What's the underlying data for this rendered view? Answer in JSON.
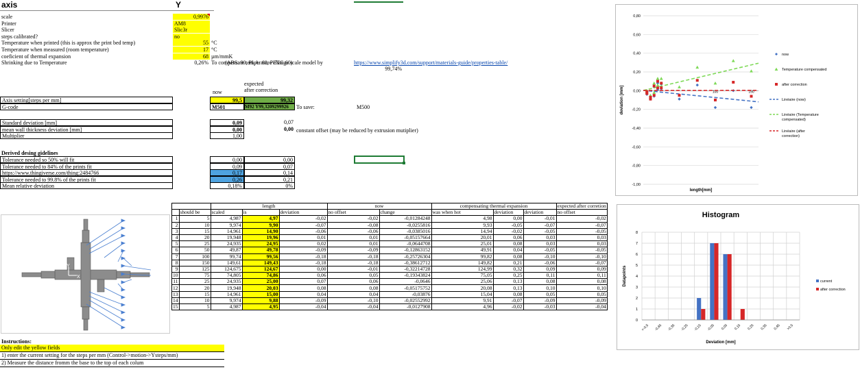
{
  "header": {
    "axis_title": "axis",
    "col_title": "Y"
  },
  "params": [
    {
      "label": "scale",
      "value": "0,9976",
      "unit": ""
    },
    {
      "label": "Printer",
      "value": "AM8",
      "unit": ""
    },
    {
      "label": "Slicer",
      "value": "Slic3r",
      "unit": ""
    },
    {
      "label": "steps calibrated?",
      "value": "no",
      "unit": ""
    },
    {
      "label": "Temperature when printed (this is approx the print bed temp)",
      "value": "55",
      "unit": "°C"
    },
    {
      "label": "Temperature when measured (room temperature)",
      "value": "17",
      "unit": "°C"
    },
    {
      "label": "coeficient of thermal expansion",
      "value": "68",
      "unit": "µm/mmK"
    },
    {
      "label": "Shrinking due to Temperature",
      "value": "0,26%",
      "unit": "To compensate temperature change scale model by"
    }
  ],
  "abs_note": "(ABS: 90, PLA: 68, PETG 60)",
  "link_simplify": "https://www.simplify3d.com/support/materials-guide/properties-table/",
  "compensate_pct": "99,74%",
  "expected_label": "expected",
  "after_correction_label": "after correction",
  "now_label": "now",
  "axis_setting": {
    "label": "Axis setting[steps per mm]",
    "now": "99,5",
    "after": "99,32"
  },
  "gcode": {
    "label": "G-code",
    "now": "M501",
    "after": "M92 Y99,3209299926",
    "to_save": "To save:",
    "save_cmd": "M500"
  },
  "stats": [
    {
      "label": "Standard deviation [mm]",
      "now": "0,09",
      "after": "0,07"
    },
    {
      "label": "mean wall thickness deviation [mm]",
      "now": "0,00",
      "after": "0,00"
    },
    {
      "label": "Multiplier",
      "now": "1,00",
      "after": ""
    }
  ],
  "constant_offset_note": "constant offset (may be reduced by extrusion mutiplier)",
  "guidelines_title": "Derived desing gidelines",
  "guidelines": [
    {
      "label": "Tolerance needed so 50% will fit",
      "now": "0,00",
      "after": "0,00"
    },
    {
      "label": "Tolerance needed to 84% of the prints fit",
      "now": "0,09",
      "after": "0,07"
    },
    {
      "label": "https://www.thingiverse.com/thing:2484766",
      "now": "0,17",
      "after": "0,14"
    },
    {
      "label": "Tolerance needed to 99.8% of the prints fit",
      "now": "0,26",
      "after": "0,21"
    },
    {
      "label": "Mean relative deviation",
      "now": "0,18%",
      "after": "0%"
    }
  ],
  "table": {
    "group_length": "length",
    "group_now": "now",
    "group_comp": "compensating thermal expansion",
    "group_expected": "expected after corretion",
    "headers": [
      "should be",
      "scaled",
      "is",
      "deviation",
      "no offset",
      "change",
      "was when hot",
      "deviation",
      "deviation",
      "no offset"
    ],
    "rows": [
      [
        "1",
        "5",
        "4,987",
        "4,97",
        "-0,02",
        "-0,02",
        "-0,01284248",
        "4,98",
        "0,00",
        "-0,01",
        "-0,02"
      ],
      [
        "2",
        "10",
        "9,974",
        "9,90",
        "-0,07",
        "-0,08",
        "-0,0255816",
        "9,93",
        "-0,05",
        "-0,07",
        "-0,07"
      ],
      [
        "3",
        "15",
        "14,961",
        "14,90",
        "-0,06",
        "-0,06",
        "-0,0385016",
        "14,94",
        "-0,02",
        "-0,05",
        "-0,05"
      ],
      [
        "4",
        "20",
        "19,948",
        "19,96",
        "0,01",
        "0,01",
        "-0,05157664",
        "20,01",
        "0,06",
        "0,03",
        "0,03"
      ],
      [
        "5",
        "25",
        "24,935",
        "24,95",
        "0,02",
        "0,01",
        "-0,0644708",
        "25,01",
        "0,08",
        "0,03",
        "0,03"
      ],
      [
        "6",
        "50",
        "49,87",
        "49,78",
        "-0,09",
        "-0,09",
        "-0,12863152",
        "49,91",
        "0,04",
        "-0,05",
        "-0,05"
      ],
      [
        "7",
        "100",
        "99,74",
        "99,56",
        "-0,18",
        "-0,18",
        "-0,25726304",
        "99,82",
        "0,08",
        "-0,10",
        "-0,10"
      ],
      [
        "8",
        "150",
        "149,61",
        "149,43",
        "-0,18",
        "-0,18",
        "-0,38612712",
        "149,82",
        "0,21",
        "-0,06",
        "-0,07"
      ],
      [
        "9",
        "125",
        "124,675",
        "124,67",
        "0,00",
        "-0,01",
        "-0,32214728",
        "124,99",
        "0,32",
        "0,09",
        "0,09"
      ],
      [
        "10",
        "75",
        "74,805",
        "74,86",
        "0,06",
        "0,05",
        "-0,19343824",
        "75,05",
        "0,25",
        "0,11",
        "0,11"
      ],
      [
        "11",
        "25",
        "24,935",
        "25,00",
        "0,07",
        "0,06",
        "-0,0646",
        "25,06",
        "0,13",
        "0,08",
        "0,08"
      ],
      [
        "12",
        "20",
        "19,948",
        "20,03",
        "0,08",
        "0,08",
        "-0,05175752",
        "20,08",
        "0,13",
        "0,10",
        "0,10"
      ],
      [
        "13",
        "15",
        "14,961",
        "15,00",
        "0,04",
        "0,04",
        "-0,03876",
        "15,04",
        "0,08",
        "0,05",
        "0,05"
      ],
      [
        "14",
        "10",
        "9,974",
        "9,88",
        "-0,09",
        "-0,10",
        "-0,02552992",
        "9,91",
        "-0,07",
        "-0,09",
        "-0,09"
      ],
      [
        "15",
        "5",
        "4,987",
        "4,95",
        "-0,04",
        "-0,04",
        "-0,0127908",
        "4,96",
        "-0,02",
        "-0,03",
        "-0,04"
      ]
    ]
  },
  "instructions": {
    "title": "Instructions:",
    "lines": [
      "Only edit the yellow fields",
      "1) enter the current setting for the steps per mm (Control->motion->Ysteps/mm)",
      "2) Measure the distance fromm the base to the top of each colum"
    ]
  },
  "colors": {
    "yellow": "#ffff00",
    "green": "#70ad47",
    "blue": "#4fa3e0",
    "now": "#4472c4",
    "temp": "#7ed957",
    "after": "#d62728"
  },
  "chart_data": [
    {
      "type": "scatter",
      "xlabel": "length[mm]",
      "ylabel": "deviation [mm]",
      "ylim": [
        -1.0,
        0.8
      ],
      "yticks": [
        "0,80",
        "0,60",
        "0,40",
        "0,20",
        "0,00",
        "-0,20",
        "-0,40",
        "-0,60",
        "-0,80",
        "-1,00"
      ],
      "xticks": [
        "100",
        "150"
      ],
      "legend_position": "right",
      "legend": [
        "now",
        "Temperature compensated",
        "after correction",
        "Linéaire (now)",
        "Linéaire (Temperature compensated)",
        "Linéaire (after correction)"
      ],
      "series": [
        {
          "name": "now",
          "x": [
            5,
            10,
            15,
            20,
            25,
            50,
            100,
            150,
            125,
            75,
            25,
            20,
            15,
            10,
            5
          ],
          "y": [
            -0.02,
            -0.07,
            -0.06,
            0.01,
            0.02,
            -0.09,
            -0.18,
            -0.18,
            0.0,
            0.06,
            0.07,
            0.08,
            0.04,
            -0.09,
            -0.04
          ]
        },
        {
          "name": "Temperature compensated",
          "x": [
            5,
            10,
            15,
            20,
            25,
            50,
            100,
            150,
            125,
            75,
            25,
            20,
            15,
            10,
            5
          ],
          "y": [
            0.0,
            -0.05,
            -0.02,
            0.06,
            0.08,
            0.04,
            0.08,
            0.21,
            0.32,
            0.25,
            0.13,
            0.13,
            0.08,
            -0.07,
            -0.02
          ]
        },
        {
          "name": "after correction",
          "x": [
            5,
            10,
            15,
            20,
            25,
            50,
            100,
            150,
            125,
            75,
            25,
            20,
            15,
            10,
            5
          ],
          "y": [
            -0.01,
            -0.07,
            -0.05,
            0.03,
            0.03,
            -0.05,
            -0.1,
            -0.06,
            0.09,
            0.11,
            0.08,
            0.1,
            0.05,
            -0.09,
            -0.03
          ]
        }
      ]
    },
    {
      "type": "bar",
      "title": "Histogram",
      "xlabel": "Deviation [mm]",
      "ylabel": "Datapoints",
      "ylim": [
        0,
        8
      ],
      "yticks": [
        "0",
        "1",
        "2",
        "3",
        "4",
        "5",
        "6",
        "7",
        "8"
      ],
      "categories": [
        "<-0,5",
        "-0,45",
        "-0,35",
        "-0,25",
        "-0,15",
        "-0,05",
        "0,05",
        "0,15",
        "0,25",
        "0,35",
        "0,45",
        ">0,5"
      ],
      "legend": [
        "current",
        "after correction"
      ],
      "series": [
        {
          "name": "current",
          "values": [
            0,
            0,
            0,
            0,
            2,
            7,
            6,
            0,
            0,
            0,
            0,
            0
          ]
        },
        {
          "name": "after correction",
          "values": [
            0,
            0,
            0,
            0,
            1,
            7,
            6,
            1,
            0,
            0,
            0,
            0
          ]
        }
      ]
    }
  ]
}
